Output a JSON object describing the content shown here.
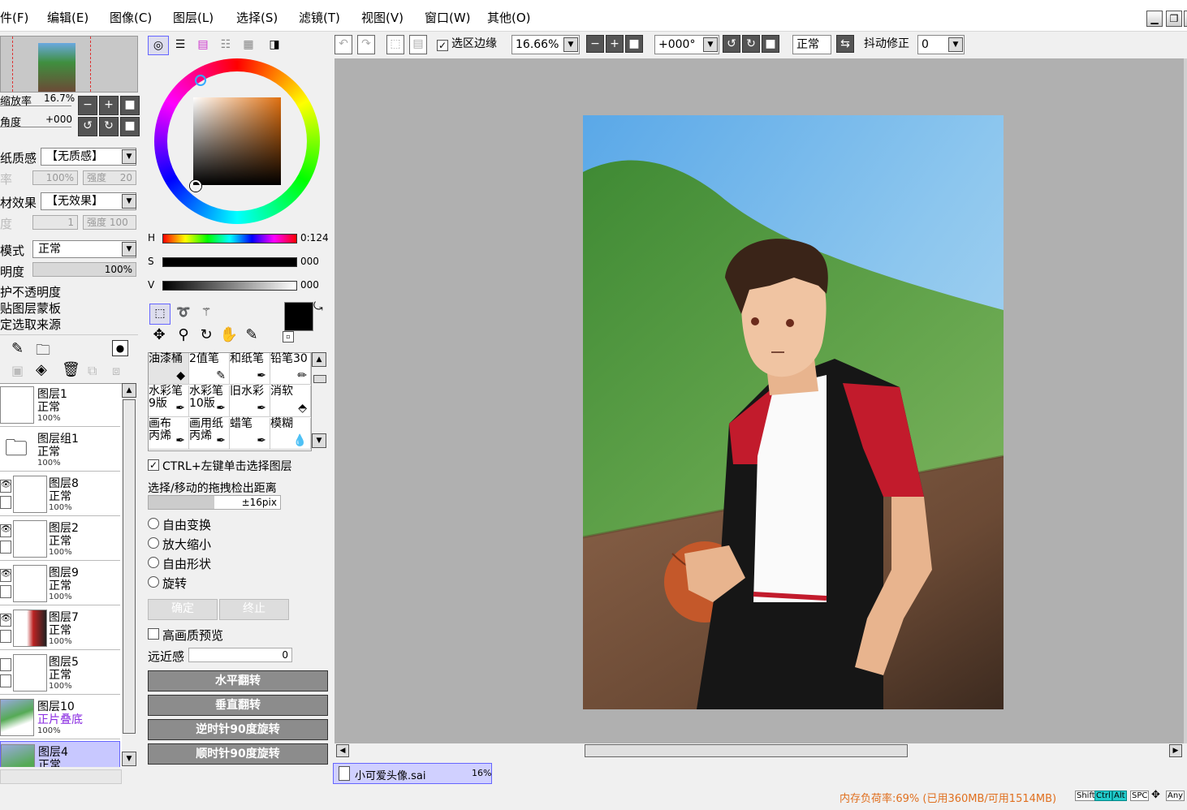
{
  "menu": {
    "items": [
      "件(F)",
      "编辑(E)",
      "图像(C)",
      "图层(L)",
      "选择(S)",
      "滤镜(T)",
      "视图(V)",
      "窗口(W)",
      "其他(O)"
    ]
  },
  "toolbar": {
    "select_edge_label": "选区边缘",
    "zoom_value": "16.66%",
    "rotate_value": "+000°",
    "blend_mode": "正常",
    "stabilizer_label": "抖动修正",
    "stabilizer_value": "0"
  },
  "navigator": {
    "zoom_label": "缩放率",
    "zoom_value": "16.7%",
    "angle_label": "角度",
    "angle_value": "+000"
  },
  "texture": {
    "paper_label": "纸质感",
    "paper_value": "【无质感】",
    "rate_label": "率",
    "rate_value": "100%",
    "strength_label": "强度",
    "strength_value": "20",
    "effect_label": "材效果",
    "effect_value": "【无效果】",
    "degree_label": "度",
    "degree_value": "1",
    "strength2_value": "强度 100"
  },
  "layer_props": {
    "mode_label": "模式",
    "mode_value": "正常",
    "opacity_label": "明度",
    "opacity_value": "100%",
    "option1": "护不透明度",
    "option2": "贴图层蒙板",
    "option3": "定选取来源"
  },
  "layers": [
    {
      "name": "图层1",
      "mode": "正常",
      "opacity": "100%"
    },
    {
      "name": "图层组1",
      "mode": "正常",
      "opacity": "100%"
    },
    {
      "name": "图层8",
      "mode": "正常",
      "opacity": "100%"
    },
    {
      "name": "图层2",
      "mode": "正常",
      "opacity": "100%"
    },
    {
      "name": "图层9",
      "mode": "正常",
      "opacity": "100%"
    },
    {
      "name": "图层7",
      "mode": "正常",
      "opacity": "100%"
    },
    {
      "name": "图层5",
      "mode": "正常",
      "opacity": "100%"
    },
    {
      "name": "图层10",
      "mode": "正片叠底",
      "opacity": "100%"
    },
    {
      "name": "图层4",
      "mode": "正常",
      "opacity": ""
    }
  ],
  "color": {
    "h_label": "H",
    "h_value": "0:124",
    "s_label": "S",
    "s_value": "000",
    "v_label": "V",
    "v_value": "000",
    "primary": "#000000",
    "secondary": "#ffffff"
  },
  "brushes": [
    {
      "top": "油漆桶",
      "bottom": ""
    },
    {
      "top": "2值笔",
      "bottom": ""
    },
    {
      "top": "和纸笔",
      "bottom": ""
    },
    {
      "top": "铅笔30",
      "bottom": ""
    },
    {
      "top": "水彩笔",
      "bottom": "9版"
    },
    {
      "top": "水彩笔",
      "bottom": "10版"
    },
    {
      "top": "旧水彩",
      "bottom": ""
    },
    {
      "top": "消软",
      "bottom": ""
    },
    {
      "top": "画布",
      "bottom": "丙烯"
    },
    {
      "top": "画用纸",
      "bottom": "丙烯"
    },
    {
      "top": "蜡笔",
      "bottom": ""
    },
    {
      "top": "模糊",
      "bottom": ""
    }
  ],
  "tool_options": {
    "ctrl_click_label": "CTRL+左键单击选择图层",
    "drag_distance_label": "选择/移动的拖拽检出距离",
    "drag_distance_value": "±16pix",
    "free_transform": "自由变换",
    "scale": "放大缩小",
    "free_shape": "自由形状",
    "rotate": "旋转",
    "confirm": "确定",
    "cancel": "终止",
    "hq_preview": "高画质预览",
    "perspective_label": "远近感",
    "perspective_value": "0",
    "flip_h": "水平翻转",
    "flip_v": "垂直翻转",
    "rot_ccw": "逆时针90度旋转",
    "rot_cw": "顺时针90度旋转"
  },
  "document_tab": {
    "name": "小可爱头像.sai",
    "zoom": "16%"
  },
  "status": {
    "memory": "内存负荷率:69% (已用360MB/可用1514MB)",
    "keys": [
      "Shift",
      "Ctrl",
      "Alt",
      "SPC",
      "Any"
    ]
  }
}
